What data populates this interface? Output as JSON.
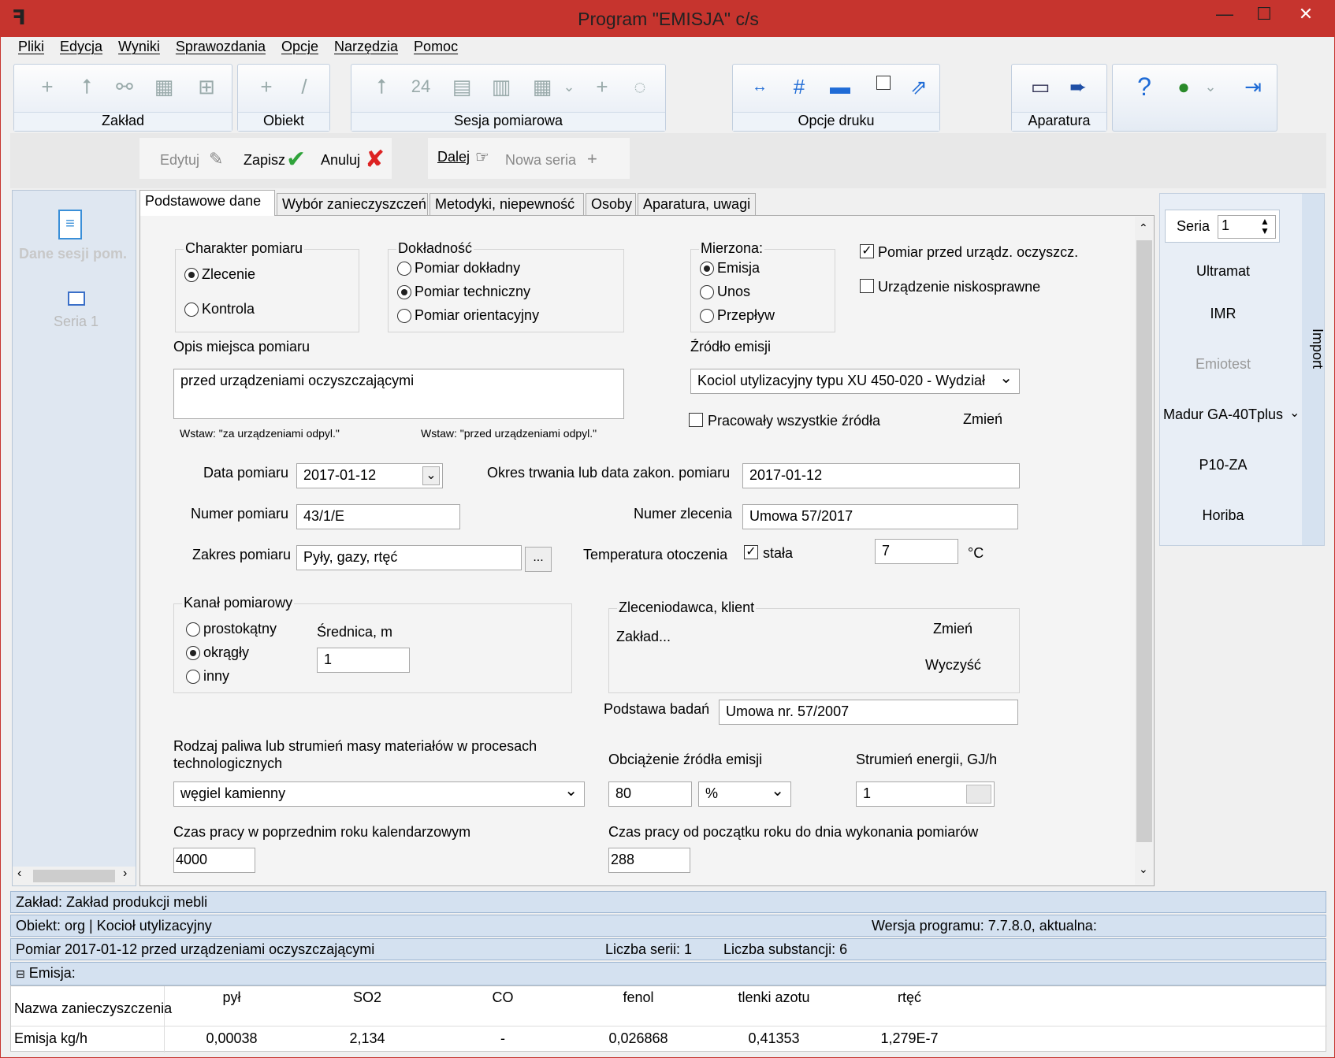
{
  "window": {
    "title": "Program \"EMISJA\" c/s",
    "min": "—",
    "max": "☐",
    "close": "✕"
  },
  "menu": [
    "Pliki",
    "Edycja",
    "Wyniki",
    "Sprawozdania",
    "Opcje",
    "Narzędzia",
    "Pomoc"
  ],
  "toolbar": {
    "zaklad": "Zakład",
    "obiekt": "Obiekt",
    "sesja": "Sesja pomiarowa",
    "sesja_num": "24",
    "druk": "Opcje druku",
    "druk_hash": "#",
    "aparatura": "Aparatura"
  },
  "actions": {
    "edytuj": "Edytuj",
    "zapisz": "Zapisz",
    "anuluj": "Anuluj",
    "dalej": "Dalej",
    "nowa_seria": "Nowa seria"
  },
  "left": {
    "item1": "Dane sesji pom.",
    "item2": "Seria 1"
  },
  "tabs": [
    "Podstawowe dane",
    "Wybór zanieczyszczeń",
    "Metodyki, niepewność",
    "Osoby",
    "Aparatura, uwagi"
  ],
  "form": {
    "charakter_title": "Charakter pomiaru",
    "charakter_opts": [
      "Zlecenie",
      "Kontrola"
    ],
    "dokladnosc_title": "Dokładność",
    "dokladnosc_opts": [
      "Pomiar dokładny",
      "Pomiar techniczny",
      "Pomiar orientacyjny"
    ],
    "mierzona_title": "Mierzona:",
    "mierzona_opts": [
      "Emisja",
      "Unos",
      "Przepływ"
    ],
    "pomiar_przed": "Pomiar przed urządz. oczyszcz.",
    "niskosprawne": "Urządzenie niskosprawne",
    "opis_label": "Opis miejsca pomiaru",
    "opis_value": "przed urządzeniami oczyszczającymi",
    "wstaw1": "Wstaw: \"za urządzeniami odpyl.\"",
    "wstaw2": "Wstaw: \"przed urządzeniami odpyl.\"",
    "zrodlo_label": "Źródło emisji",
    "zrodlo_value": "Kociol utylizacyjny typu XU 450-020 - Wydział",
    "pracowaly": "Pracowały wszystkie źródła",
    "zmien": "Zmień",
    "data_label": "Data pomiaru",
    "data_value": "2017-01-12",
    "okres_label": "Okres trwania lub data zakon. pomiaru",
    "okres_value": "2017-01-12",
    "numer_label": "Numer pomiaru",
    "numer_value": "43/1/E",
    "zlecenie_label": "Numer zlecenia",
    "zlecenie_value": "Umowa 57/2017",
    "zakres_label": "Zakres pomiaru",
    "zakres_value": "Pyły, gazy, rtęć",
    "zakres_btn": "...",
    "temp_label": "Temperatura otoczenia",
    "stala": "stała",
    "temp_value": "7",
    "temp_unit": "°C",
    "kanal_title": "Kanał pomiarowy",
    "kanal_opts": [
      "prostokątny",
      "okrągły",
      "inny"
    ],
    "srednica_label": "Średnica, m",
    "srednica_value": "1",
    "zlec_title": "Zleceniodawca, klient",
    "zlec_value": "Zakład...",
    "zlec_zmien": "Zmień",
    "zlec_wyczysc": "Wyczyść",
    "podstawa_label": "Podstawa badań",
    "podstawa_value": "Umowa nr. 57/2007",
    "paliwo_label": "Rodzaj paliwa lub strumień masy materiałów w procesach technologicznych",
    "paliwo_value": "węgiel kamienny",
    "obciazenie_label": "Obciążenie źródła emisji",
    "obciazenie_value": "80",
    "obciazenie_unit": "%",
    "strumien_label": "Strumień energii, GJ/h",
    "strumien_value": "1",
    "czas_poprz_label": "Czas pracy w poprzednim roku kalendarzowym",
    "czas_poprz_value": "4000",
    "czas_od_label": "Czas pracy od początku roku do dnia wykonania pomiarów",
    "czas_od_value": "288"
  },
  "right": {
    "seria_label": "Seria",
    "seria_value": "1",
    "items": [
      "Ultramat",
      "IMR",
      "Emiotest",
      "Madur GA-40Tplus",
      "P10-ZA",
      "Horiba"
    ],
    "import": "Import"
  },
  "status": {
    "zaklad": "Zakład: Zakład produkcji mebli",
    "obiekt": "Obiekt: org | Kocioł utylizacyjny",
    "wersja": "Wersja programu: 7.7.8.0,  aktualna:",
    "pomiar": "Pomiar 2017-01-12 przed urządzeniami oczyszczającymi",
    "serii": "Liczba serii: 1",
    "substancji": "Liczba substancji: 6",
    "emisja": "Emisja:"
  },
  "table": {
    "row1_label": "Nazwa zanieczyszczenia",
    "row2_label": "Emisja kg/h",
    "headers": [
      "pył",
      "SO2",
      "CO",
      "fenol",
      "tlenki azotu",
      "rtęć"
    ],
    "values": [
      "0,00038",
      "2,134",
      "-",
      "0,026868",
      "0,41353",
      "1,279E-7"
    ]
  }
}
